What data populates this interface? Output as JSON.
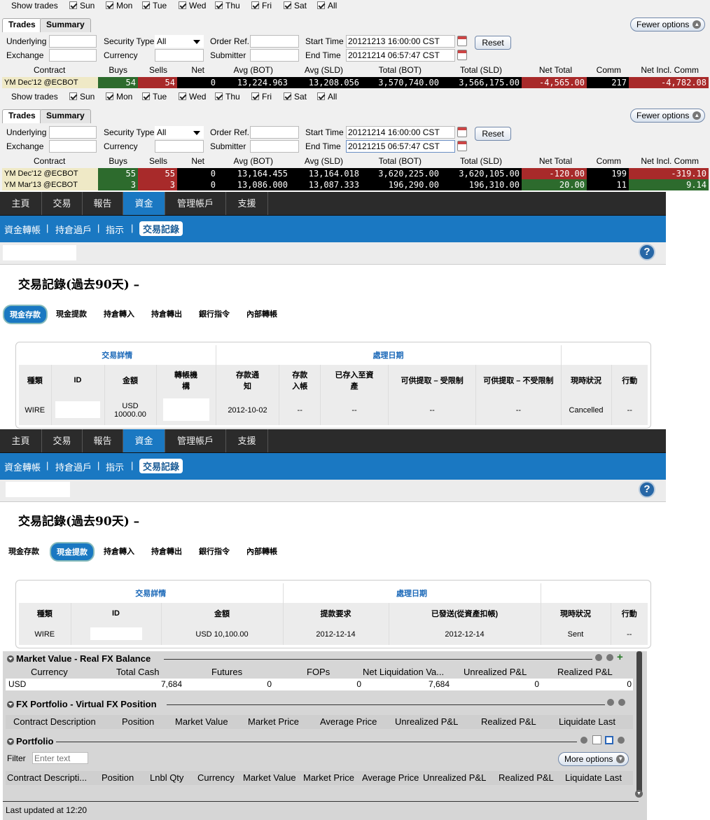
{
  "trades_panels": [
    {
      "show_trades_label": "Show trades",
      "days": [
        "Sun",
        "Mon",
        "Tue",
        "Wed",
        "Thu",
        "Fri",
        "Sat",
        "All"
      ],
      "tabs": [
        "Trades",
        "Summary"
      ],
      "fewer_options": "Fewer options",
      "fields": {
        "underlying_label": "Underlying",
        "underlying_value": "",
        "security_type_label": "Security Type",
        "security_type_value": "All",
        "order_ref_label": "Order Ref.",
        "order_ref_value": "",
        "start_time_label": "Start Time",
        "start_time_value": "20121213 16:00:00 CST",
        "exchange_label": "Exchange",
        "exchange_value": "",
        "currency_label": "Currency",
        "currency_value": "",
        "submitter_label": "Submitter",
        "submitter_value": "",
        "end_time_label": "End Time",
        "end_time_value": "20121214 06:57:47 CST"
      },
      "reset": "Reset",
      "columns": [
        "Contract",
        "Buys",
        "Sells",
        "Net",
        "Avg (BOT)",
        "Avg (SLD)",
        "Total (BOT)",
        "Total (SLD)",
        "Net Total",
        "Comm",
        "Net Incl. Comm"
      ],
      "rows": [
        {
          "contract": "YM Dec'12 @ECBOT",
          "buys": "54",
          "sells": "54",
          "net": "0",
          "avg_bot": "13,224.963",
          "avg_sld": "13,208.056",
          "total_bot": "3,570,740.00",
          "total_sld": "3,566,175.00",
          "net_total": "-4,565.00",
          "comm": "217",
          "net_incl": "-4,782.08"
        }
      ]
    },
    {
      "show_trades_label": "Show trades",
      "days": [
        "Sun",
        "Mon",
        "Tue",
        "Wed",
        "Thu",
        "Fri",
        "Sat",
        "All"
      ],
      "tabs": [
        "Trades",
        "Summary"
      ],
      "fewer_options": "Fewer options",
      "fields": {
        "underlying_label": "Underlying",
        "underlying_value": "",
        "security_type_label": "Security Type",
        "security_type_value": "All",
        "order_ref_label": "Order Ref.",
        "order_ref_value": "",
        "start_time_label": "Start Time",
        "start_time_value": "20121214 16:00:00 CST",
        "exchange_label": "Exchange",
        "exchange_value": "",
        "currency_label": "Currency",
        "currency_value": "",
        "submitter_label": "Submitter",
        "submitter_value": "",
        "end_time_label": "End Time",
        "end_time_value": "20121215 06:57:47 CST"
      },
      "reset": "Reset",
      "columns": [
        "Contract",
        "Buys",
        "Sells",
        "Net",
        "Avg (BOT)",
        "Avg (SLD)",
        "Total (BOT)",
        "Total (SLD)",
        "Net Total",
        "Comm",
        "Net Incl. Comm"
      ],
      "rows": [
        {
          "contract": "YM Dec'12 @ECBOT",
          "buys": "55",
          "sells": "55",
          "net": "0",
          "avg_bot": "13,164.455",
          "avg_sld": "13,164.018",
          "total_bot": "3,620,225.00",
          "total_sld": "3,620,105.00",
          "net_total": "-120.00",
          "comm": "199",
          "net_incl": "-319.10"
        },
        {
          "contract": "YM Mar'13 @ECBOT",
          "buys": "3",
          "sells": "3",
          "net": "0",
          "avg_bot": "13,086.000",
          "avg_sld": "13,087.333",
          "total_bot": "196,290.00",
          "total_sld": "196,310.00",
          "net_total": "20.00",
          "comm": "11",
          "net_incl": "9.14"
        }
      ]
    }
  ],
  "portal": [
    {
      "nav": [
        "主頁",
        "交易",
        "報告",
        "資金",
        "管理帳戶",
        "支援"
      ],
      "nav_active": "資金",
      "sub": [
        "資金轉帳",
        "持倉過戶",
        "指示",
        "交易記錄"
      ],
      "sub_sep": "|",
      "help": "?",
      "title": "交易記錄(過去90天) –",
      "tabs": [
        "現金存款",
        "現金提款",
        "持倉轉入",
        "持倉轉出",
        "銀行指令",
        "內部轉帳"
      ],
      "active_tab": "現金存款",
      "group_headers": [
        "交易詳情",
        "處理日期"
      ],
      "columns": [
        "種類",
        "ID",
        "金額",
        "轉帳機構",
        "存款通知",
        "存款入帳",
        "已存入至資產",
        "可供提取 – 受限制",
        "可供提取 – 不受限制",
        "現時狀況",
        "行動"
      ],
      "row": [
        "WIRE",
        "",
        "USD 10000.00",
        "",
        "2012-10-02",
        "--",
        "--",
        "--",
        "--",
        "Cancelled",
        "--"
      ]
    },
    {
      "nav": [
        "主頁",
        "交易",
        "報告",
        "資金",
        "管理帳戶",
        "支援"
      ],
      "nav_active": "資金",
      "sub": [
        "資金轉帳",
        "持倉過戶",
        "指示",
        "交易記錄"
      ],
      "sub_sep": "|",
      "help": "?",
      "title": "交易記錄(過去90天) –",
      "tabs": [
        "現金存款",
        "現金提款",
        "持倉轉入",
        "持倉轉出",
        "銀行指令",
        "內部轉帳"
      ],
      "active_tab": "現金提款",
      "group_headers": [
        "交易詳情",
        "處理日期"
      ],
      "columns": [
        "種類",
        "ID",
        "金額",
        "提款要求",
        "已發送(從資產扣帳)",
        "現時狀況",
        "行動"
      ],
      "row": [
        "WIRE",
        "",
        "USD 10,100.00",
        "2012-12-14",
        "2012-12-14",
        "Sent",
        "--"
      ]
    }
  ],
  "tws": {
    "market_value": {
      "title": "Market Value - Real FX Balance",
      "columns": [
        "Currency",
        "Total Cash",
        "Futures",
        "FOPs",
        "Net Liquidation Va...",
        "Unrealized P&L",
        "Realized P&L"
      ],
      "row": [
        "USD",
        "7,684",
        "0",
        "0",
        "7,684",
        "0",
        "0"
      ]
    },
    "fx_portfolio": {
      "title": "FX Portfolio - Virtual FX Position",
      "columns": [
        "Contract Description",
        "Position",
        "Market Value",
        "Market Price",
        "Average Price",
        "Unrealized P&L",
        "Realized P&L",
        "Liquidate Last"
      ]
    },
    "portfolio": {
      "title": "Portfolio",
      "filter_label": "Filter",
      "filter_placeholder": "Enter text",
      "more_options": "More options",
      "columns": [
        "Contract Descripti...",
        "Position",
        "Lnbl Qty",
        "Currency",
        "Market Value",
        "Market Price",
        "Average Price",
        "Unrealized P&L",
        "Realized P&L",
        "Liquidate Last"
      ]
    },
    "last_updated": "Last updated at 12:20"
  },
  "colors": {
    "buy_green": "#2d6b2d",
    "sell_red": "#a82a2a",
    "neg_red": "#a82a2a",
    "pos_green": "#2d6b2d",
    "dark_cell": "#000000",
    "nav_bg": "#2b2b2b",
    "accent_blue": "#1a78c2"
  }
}
